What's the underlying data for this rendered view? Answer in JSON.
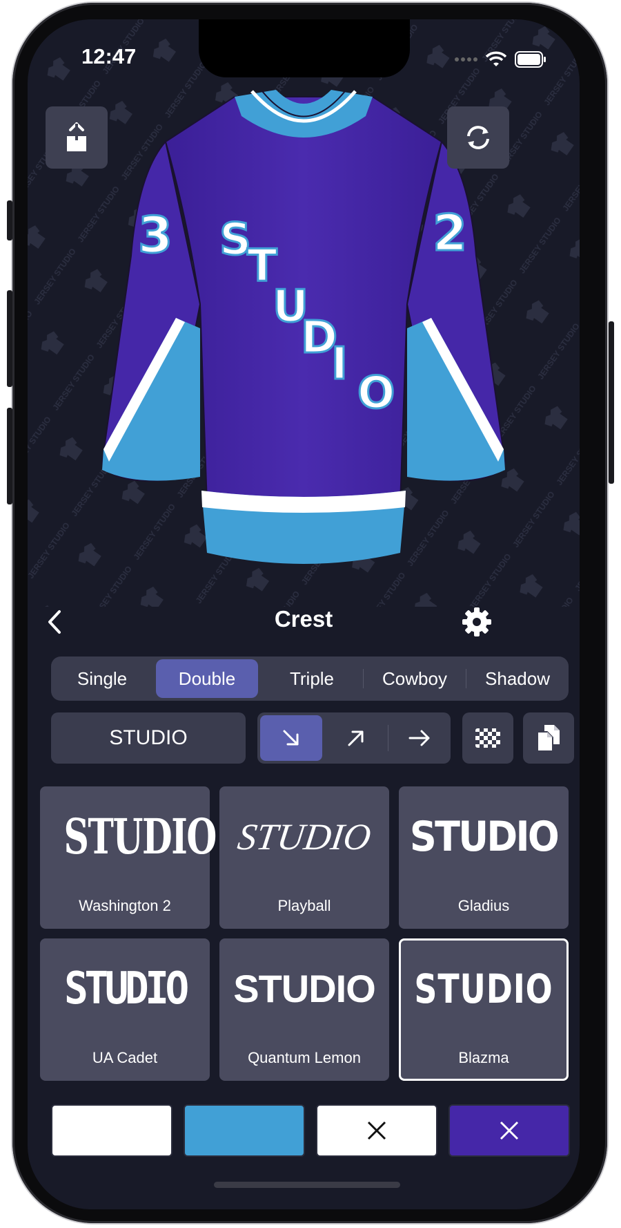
{
  "status_bar": {
    "time": "12:47"
  },
  "jersey": {
    "sleeve_left_number": "3",
    "sleeve_right_number": "2",
    "crest_text": "STUDIO",
    "colors": {
      "body": "#4527a8",
      "trim": "#41a0d6",
      "stripe": "#ffffff",
      "background": "#181a28"
    },
    "watermark": "JERSEY STUDIO"
  },
  "nav": {
    "title": "Crest",
    "back_icon": "chevron-left-icon",
    "settings_icon": "gear-icon"
  },
  "style_tabs": [
    {
      "label": "Single",
      "active": false
    },
    {
      "label": "Double",
      "active": true
    },
    {
      "label": "Triple",
      "active": false
    },
    {
      "label": "Cowboy",
      "active": false
    },
    {
      "label": "Shadow",
      "active": false
    }
  ],
  "text_field": {
    "value": "STUDIO"
  },
  "angle_options": [
    {
      "icon": "arrow-down-right-icon",
      "active": true
    },
    {
      "icon": "arrow-up-right-icon",
      "active": false
    },
    {
      "icon": "arrow-right-icon",
      "active": false
    }
  ],
  "tools": {
    "pattern_icon": "checkerboard-icon",
    "copy_icon": "copy-icon"
  },
  "fonts": [
    {
      "name": "Washington 2",
      "preview": "STUDIO",
      "selected": false
    },
    {
      "name": "Playball",
      "preview": "STUDIO",
      "selected": false
    },
    {
      "name": "Gladius",
      "preview": "STUDIO",
      "selected": false
    },
    {
      "name": "UA Cadet",
      "preview": "STUDIO",
      "selected": false
    },
    {
      "name": "Quantum Lemon",
      "preview": "STUDIO",
      "selected": false
    },
    {
      "name": "Blazma",
      "preview": "STUDIO",
      "selected": true
    }
  ],
  "swatches": [
    {
      "color": "#ffffff",
      "cleared": false
    },
    {
      "color": "#41a0d6",
      "cleared": false
    },
    {
      "color": "#ffffff",
      "cleared": true
    },
    {
      "color": "#4527a8",
      "cleared": true
    }
  ]
}
